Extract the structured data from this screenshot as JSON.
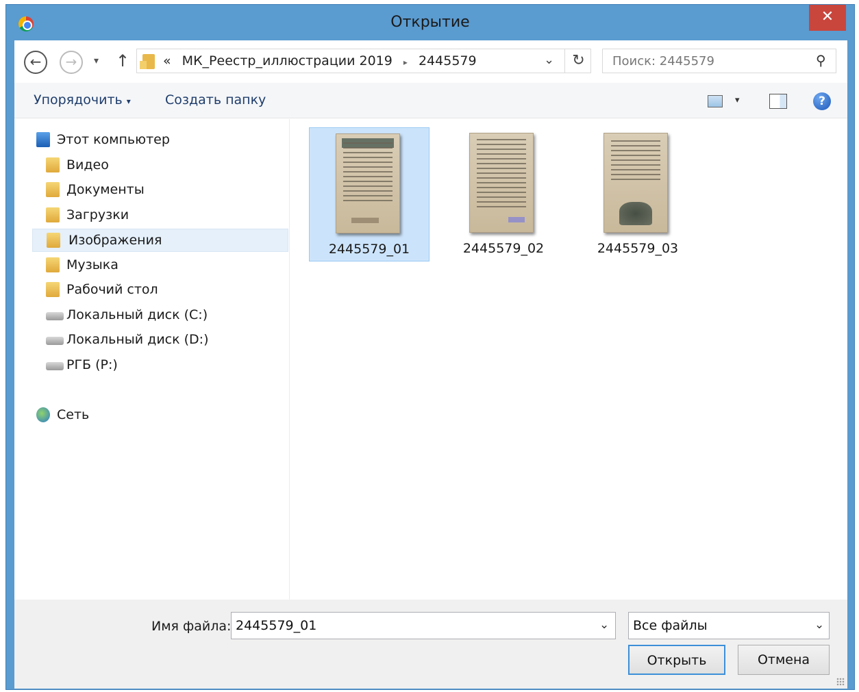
{
  "window": {
    "title": "Открытие",
    "close_glyph": "✕"
  },
  "addressbar": {
    "back_glyph": "←",
    "forward_glyph": "→",
    "recent_glyph": "▾",
    "up_glyph": "↑",
    "path_overflow": "«",
    "path": [
      "МК_Реестр_иллюстрации 2019",
      "2445579"
    ],
    "path_separator": "▸",
    "dropdown_glyph": "⌄",
    "refresh_glyph": "↻",
    "search_placeholder": "Поиск: 2445579",
    "search_glyph": "⚲"
  },
  "toolbar": {
    "organize_label": "Упорядочить",
    "organize_caret": "▾",
    "new_folder_label": "Создать папку",
    "view_caret": "▾",
    "help_glyph": "?"
  },
  "navigation": {
    "items": [
      {
        "label": "Этот компьютер",
        "icon": "computer-icon"
      },
      {
        "label": "Видео",
        "icon": "folder-icon"
      },
      {
        "label": "Документы",
        "icon": "folder-icon"
      },
      {
        "label": "Загрузки",
        "icon": "folder-icon"
      },
      {
        "label": "Изображения",
        "icon": "folder-icon",
        "selected": true
      },
      {
        "label": "Музыка",
        "icon": "folder-icon"
      },
      {
        "label": "Рабочий стол",
        "icon": "folder-icon"
      },
      {
        "label": "Локальный диск (C:)",
        "icon": "drive-icon"
      },
      {
        "label": "Локальный диск (D:)",
        "icon": "drive-icon"
      },
      {
        "label": "РГБ (P:)",
        "icon": "network-drive-icon"
      },
      {
        "label": "Сеть",
        "icon": "network-icon"
      }
    ]
  },
  "files": [
    {
      "name": "2445579_01",
      "selected": true
    },
    {
      "name": "2445579_02",
      "selected": false
    },
    {
      "name": "2445579_03",
      "selected": false
    }
  ],
  "footer": {
    "filename_label": "Имя файла:",
    "filename_value": "2445579_01",
    "filename_caret": "⌄",
    "filter_value": "Все файлы",
    "filter_caret": "⌄",
    "open_label": "Открыть",
    "cancel_label": "Отмена"
  },
  "colors": {
    "titlebar": "#5a9bd0",
    "close": "#c9463d",
    "selection": "#cce4fb",
    "accent": "#3c8fd8"
  }
}
